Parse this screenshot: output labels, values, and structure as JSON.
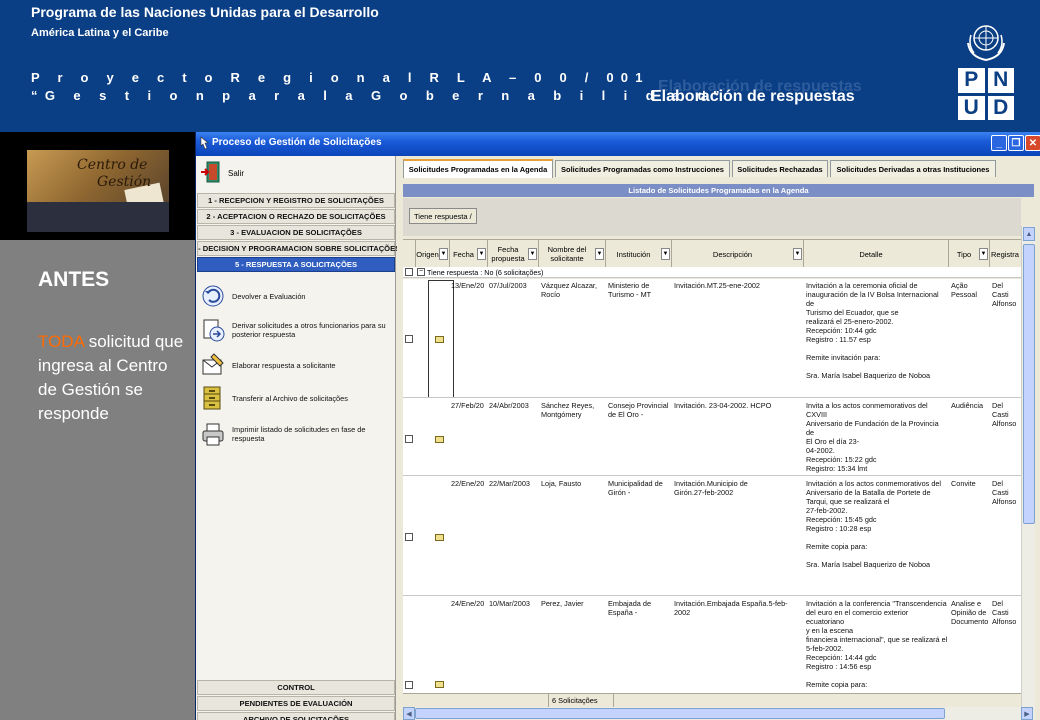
{
  "slide": {
    "org_title": "Programa de las  Naciones Unidas para el  Desarrollo",
    "org_subtitle": "América Latina y el Caribe",
    "project_line": "P r o y e c t o   R e g i o n a l  R L A – 0 0 / 001",
    "project_name": "“G e s t i o n  p a r a  l a  G o b e r n a b i l i d a d”",
    "section_shadow": "Elaboración de respuestas",
    "section_title": "Elaboración de respuestas",
    "logo_letters": [
      "P",
      "N",
      "U",
      "D"
    ],
    "antes": "ANTES",
    "note_highlight": "TODA",
    "note_rest": " solicitud que ingresa al Centro de Gestión se responde",
    "thumb_title_1": "Centro de",
    "thumb_title_2": "Gestión",
    "colors": {
      "header_bg": "#0b3f85",
      "highlight": "#ff6a00",
      "panel_bg": "#808080"
    }
  },
  "window": {
    "title": "Proceso de Gestión de Solicitações",
    "controls": [
      "minimize-icon",
      "restore-icon",
      "close-icon"
    ]
  },
  "sidebar": {
    "salir": "Salir",
    "steps": [
      "1 - RECEPCION Y REGISTRO DE SOLICITAÇÕES",
      "2 - ACEPTACION O RECHAZO DE SOLICITAÇÕES",
      "3 - EVALUACION DE SOLICITAÇÕES",
      "4 - DECISION Y PROGRAMACION SOBRE SOLICITAÇÕES",
      "5 - RESPUESTA A SOLICITAÇÕES"
    ],
    "actions": [
      "Devolver a Evaluación",
      "Derivar solicitudes a otros funcionarios para su posterior respuesta",
      "Elaborar respuesta a solicitante",
      "Transferir al Archivo de solicitações",
      "Imprimir listado de solicitudes en fase de respuesta"
    ],
    "bottom": [
      "CONTROL",
      "PENDIENTES DE EVALUACIÓN",
      "ARCHIVO DE SOLICITAÇÕES"
    ]
  },
  "tabs": [
    "Solicitudes Programadas en la Agenda",
    "Solicitudes Programadas como Instrucciones",
    "Solicitudes Rechazadas",
    "Solicitudes Derivadas a otras Instituciones"
  ],
  "list_title": "Listado de Solicitudes Programadas en la Agenda",
  "group_box": "Tiene respuesta  /",
  "group_row": "Tiene respuesta : No   (6 solicitações)",
  "columns": [
    "Origen",
    "Fecha",
    "Fecha propuesta",
    "Nombre del solicitante",
    "Institución",
    "Descripción",
    "Detalle",
    "Tipo",
    "Registra"
  ],
  "rows": [
    {
      "fecha": "13/Ene/20",
      "propuesta": "07/Jul/2003",
      "nombre": "Vázquez Alcazar,\nRocío",
      "institucion": "Ministerio de\nTurismo - MT",
      "descripcion": "Invitación.MT.25-ene-2002",
      "detalle": "Invitación a la ceremonia oficial de\ninauguración de la IV Bolsa Internacional de\nTurismo del Ecuador, que se\nrealizará el 25-enero-2002.\nRecepción:  10:44  gdc\nRegistro   :  11.57  esp\n\nRemite invitación para:\n\nSra. María Isabel Baquerizo de Noboa",
      "tipo": "Ação\nPessoal",
      "registra": "Del Casti\nAlfonso"
    },
    {
      "fecha": "27/Feb/20",
      "propuesta": "24/Abr/2003",
      "nombre": "Sánchez Reyes,\nMontgómery",
      "institucion": "Consejo Provincial\nde El Oro -",
      "descripcion": "Invitación. 23-04-2002.  HCPO",
      "detalle": "Invita a los actos conmemorativos del CXVIII\nAniversario de Fundación de la Provincia de\nEl Oro el día 23-\n04-2002.\nRecepción: 15:22 gdc\nRegistro:      15:34 lmt",
      "tipo": "Audiência",
      "registra": "Del Casti\nAlfonso"
    },
    {
      "fecha": "22/Ene/20",
      "propuesta": "22/Mar/2003",
      "nombre": "Loja, Fausto",
      "institucion": "Municipalidad de\nGirón -",
      "descripcion": "Invitación.Municipio de\nGirón.27-feb-2002",
      "detalle": "Invitación a los actos conmemorativos del\nAniversario de la Batalla de Portete de\nTarqui, que se realizará el\n27-feb-2002.\nRecepción:   15:45   gdc\nRegistro   :  10:28  esp\n\nRemite copia para:\n\nSra. María Isabel Baquerizo de Noboa",
      "tipo": "Convite",
      "registra": "Del Casti\nAlfonso"
    },
    {
      "fecha": "24/Ene/20",
      "propuesta": "10/Mar/2003",
      "nombre": "Perez, Javier",
      "institucion": "Embajada de\nEspaña -",
      "descripcion": "Invitación.Embajada España.5-feb-2002",
      "detalle": "Invitación a la conferencia \"Transcendencia\ndel euro en el comercio exterior ecuatoriano\ny en la escena\nfinanciera internacional\", que se realizará el\n5-feb-2002.\nRecepción:   14:44  gdc\nRegistro   :  14:56  esp\n\nRemite copia para:",
      "tipo": "Analise e\nOpinião de\nDocumento",
      "registra": "Del Casti\nAlfonso"
    }
  ],
  "footer_count": "6 Solicitações"
}
